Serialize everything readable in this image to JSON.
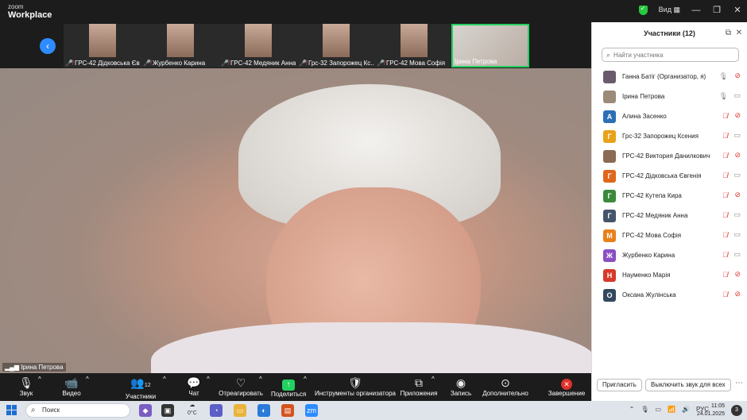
{
  "app": {
    "logo_small": "zoom",
    "logo_main": "Workplace",
    "view_label": "Вид"
  },
  "thumbnails": [
    {
      "name": "ГРС-42 Дідковська Єв...",
      "muted": true
    },
    {
      "name": "Журбенко Карина",
      "muted": true
    },
    {
      "name": "ГРС-42 Медяник Анна",
      "muted": true
    },
    {
      "name": "Грс-32 Запорожец Кс...",
      "muted": true
    },
    {
      "name": "ГРС-42 Мова Софія",
      "muted": true
    },
    {
      "name": "Ірина Петрова",
      "muted": false
    }
  ],
  "main_video": {
    "speaker_name": "Ірина Петрова"
  },
  "toolbar": {
    "audio": "Звук",
    "video": "Видео",
    "participants": "Участники",
    "participants_count": "12",
    "chat": "Чат",
    "react": "Отреагировать",
    "share": "Поделиться",
    "host_tools": "Инструменты организатора",
    "apps": "Приложения",
    "record": "Запись",
    "more": "Дополнительно",
    "end": "Завершение"
  },
  "panel": {
    "title": "Участники (12)",
    "search_placeholder": "Найти участника",
    "invite": "Пригласить",
    "mute_all": "Выключить звук для всех",
    "participants": [
      {
        "name": "Ганна Батіг (Организатор, я)",
        "avatar": "",
        "color": "#6b5a6e",
        "mic": "on",
        "cam": "off"
      },
      {
        "name": "Ірина Петрова",
        "avatar": "",
        "color": "#9c8a78",
        "mic": "on",
        "cam": "on"
      },
      {
        "name": "Алина Засенко",
        "avatar": "А",
        "color": "#2d6fb6",
        "mic": "muted",
        "cam": "off"
      },
      {
        "name": "Грс-32 Запорожец Ксения",
        "avatar": "Г",
        "color": "#e8a21a",
        "mic": "muted",
        "cam": "on"
      },
      {
        "name": "ГРС-42 Виктория Данилкович",
        "avatar": "",
        "color": "#8a6a52",
        "mic": "muted",
        "cam": "off"
      },
      {
        "name": "ГРС-42 Дідковська Євгенія",
        "avatar": "Г",
        "color": "#e0671b",
        "mic": "muted",
        "cam": "on"
      },
      {
        "name": "ГРС-42 Кутепа Кира",
        "avatar": "Г",
        "color": "#3a8a3a",
        "mic": "muted",
        "cam": "off"
      },
      {
        "name": "ГРС-42 Медяник Анна",
        "avatar": "Г",
        "color": "#44546a",
        "mic": "muted",
        "cam": "on"
      },
      {
        "name": "ГРС-42 Мова Софія",
        "avatar": "М",
        "color": "#e8801a",
        "mic": "muted",
        "cam": "on"
      },
      {
        "name": "Журбенко Карина",
        "avatar": "Ж",
        "color": "#8a4fc2",
        "mic": "muted",
        "cam": "on"
      },
      {
        "name": "Науменко Марія",
        "avatar": "Н",
        "color": "#d63a2a",
        "mic": "muted",
        "cam": "off"
      },
      {
        "name": "Оксана Жулінська",
        "avatar": "О",
        "color": "#34495e",
        "mic": "muted",
        "cam": "off"
      }
    ]
  },
  "taskbar": {
    "search_placeholder": "Поиск",
    "weather_temp": "0°C",
    "lang": "РУС",
    "time": "11:05",
    "date": "24.01.2025",
    "notifications": "3"
  }
}
